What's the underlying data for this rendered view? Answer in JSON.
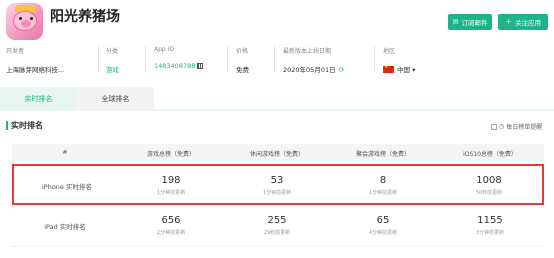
{
  "app": {
    "title": "阳光养猪场",
    "icon": "pig-app-icon"
  },
  "actions": {
    "subscribe_label": "订阅邮件",
    "subscribe_icon": "mail-icon",
    "favorite_label": "关注应用",
    "favorite_icon": "plus-icon",
    "button_color": "#1fb38a"
  },
  "meta": {
    "developer_label": "开发者",
    "developer_value": "上海脉芽网络科技...",
    "category_label": "分类",
    "category_value": "游戏",
    "appid_label": "App ID",
    "appid_value": "1483408788",
    "price_label": "价格",
    "price_value": "免费",
    "last_online_label": "最新版本上线日期",
    "last_online_value": "2020年05月01日",
    "region_label": "地区",
    "region_value": "中国"
  },
  "tabs": [
    {
      "label": "实时排名",
      "active": true
    },
    {
      "label": "全球排名",
      "active": false
    }
  ],
  "section": {
    "title": "实时排名",
    "hourly_label": "每日榜单提醒"
  },
  "table": {
    "headers": [
      "#",
      "游戏总榜（免费）",
      "休闲游戏榜（免费）",
      "聚会游戏榜（免费）",
      "iOS10总榜（免费）"
    ],
    "rows": [
      {
        "label": "iPhone 实时排名",
        "highlighted": true,
        "cells": [
          {
            "rank": "198",
            "update": "1分钟前更新"
          },
          {
            "rank": "53",
            "update": "1分钟前更新"
          },
          {
            "rank": "8",
            "update": "1分钟前更新"
          },
          {
            "rank": "1008",
            "update": "50秒前更新"
          }
        ]
      },
      {
        "label": "iPad 实时排名",
        "highlighted": false,
        "cells": [
          {
            "rank": "656",
            "update": "2分钟前更新"
          },
          {
            "rank": "255",
            "update": "29秒前更新"
          },
          {
            "rank": "65",
            "update": "4分钟前更新"
          },
          {
            "rank": "1155",
            "update": "3分钟前更新"
          }
        ]
      }
    ],
    "highlight_color": "#e53935"
  }
}
